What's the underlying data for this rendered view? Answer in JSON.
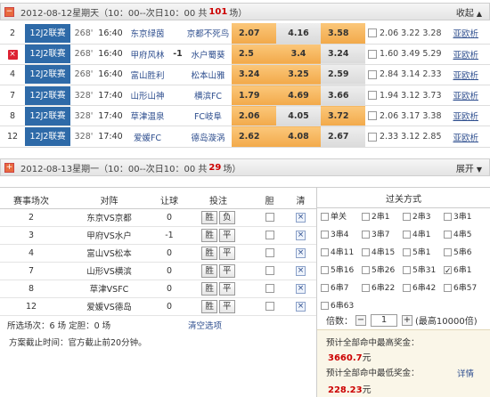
{
  "day1": {
    "date": "2012-08-12星期天",
    "period": "（10：00--次日10：00 共",
    "count": "101",
    "unit": "场）",
    "action": "收起",
    "arrow": "▲",
    "toggle": "−"
  },
  "day2": {
    "date": "2012-08-13星期一",
    "period": "（10：00--次日10：00 共",
    "count": "29",
    "unit": "场）",
    "action": "展开",
    "arrow": "▼",
    "toggle": "+"
  },
  "matches": [
    {
      "no": "2",
      "league": "12J2联赛",
      "id": "268'",
      "time": "16:40",
      "home": "东京绿茵",
      "hc": "",
      "away": "京都不死鸟",
      "o1": "2.07",
      "o2": "4.16",
      "o3": "3.58",
      "hist": "2.06 3.22 3.28",
      "link": "亚欧析"
    },
    {
      "no": "×",
      "league": "12J2联赛",
      "id": "268'",
      "time": "16:40",
      "home": "甲府风林",
      "hc": "-1",
      "away": "水户蜀葵",
      "o1": "2.5",
      "o2": "3.4",
      "o3": "3.24",
      "hist": "1.60 3.49 5.29",
      "link": "亚欧析"
    },
    {
      "no": "4",
      "league": "12J2联赛",
      "id": "268'",
      "time": "16:40",
      "home": "富山胜利",
      "hc": "",
      "away": "松本山雅",
      "o1": "3.24",
      "o2": "3.25",
      "o3": "2.59",
      "hist": "2.84 3.14 2.33",
      "link": "亚欧析"
    },
    {
      "no": "7",
      "league": "12J2联赛",
      "id": "328'",
      "time": "17:40",
      "home": "山形山神",
      "hc": "",
      "away": "横滨FC",
      "o1": "1.79",
      "o2": "4.69",
      "o3": "3.66",
      "hist": "1.94 3.12 3.73",
      "link": "亚欧析"
    },
    {
      "no": "8",
      "league": "12J2联赛",
      "id": "328'",
      "time": "17:40",
      "home": "草津温泉",
      "hc": "",
      "away": "FC岐阜",
      "o1": "2.06",
      "o2": "4.05",
      "o3": "3.72",
      "hist": "2.06 3.17 3.38",
      "link": "亚欧析"
    },
    {
      "no": "12",
      "league": "12J2联赛",
      "id": "328'",
      "time": "17:40",
      "home": "爱媛FC",
      "hc": "",
      "away": "德岛漩涡",
      "o1": "2.62",
      "o2": "4.08",
      "o3": "2.67",
      "hist": "2.33 3.12 2.85",
      "link": "亚欧析"
    }
  ],
  "selection": {
    "headers": [
      "赛事场次",
      "对阵",
      "让球",
      "投注",
      "胆",
      "清"
    ],
    "rows": [
      {
        "no": "2",
        "match": "东京VS京都",
        "hc": "0",
        "bets": [
          "胜",
          "负"
        ]
      },
      {
        "no": "3",
        "match": "甲府VS水户",
        "hc": "-1",
        "bets": [
          "胜",
          "平"
        ]
      },
      {
        "no": "4",
        "match": "富山VS松本",
        "hc": "0",
        "bets": [
          "胜",
          "平"
        ]
      },
      {
        "no": "7",
        "match": "山形VS横滨",
        "hc": "0",
        "bets": [
          "胜",
          "平"
        ]
      },
      {
        "no": "8",
        "match": "草津VSFC",
        "hc": "0",
        "bets": [
          "胜",
          "平"
        ]
      },
      {
        "no": "12",
        "match": "爱媛VS德岛",
        "hc": "0",
        "bets": [
          "胜",
          "平"
        ]
      }
    ],
    "del": "×",
    "summary": "所选场次：6 场 定胆：0 场",
    "clear": "清空选项",
    "note": "方案截止时间：官方截止前20分钟。"
  },
  "pass": {
    "title": "过关方式",
    "options": [
      "单关",
      "2串1",
      "2串3",
      "3串1",
      "3串4",
      "3串7",
      "4串1",
      "4串5",
      "4串11",
      "4串15",
      "5串1",
      "5串6",
      "5串16",
      "5串26",
      "5串31",
      "6串1",
      "6串7",
      "6串22",
      "6串42",
      "6串57",
      "6串63"
    ],
    "checked": "6串1"
  },
  "multiple": {
    "label": "倍数：",
    "minus": "−",
    "value": "1",
    "plus": "+",
    "hint": "(最高10000倍)"
  },
  "prize": {
    "max_label": "预计全部命中最高奖金：",
    "max_value": "3660.7",
    "min_label": "预计全部命中最低奖金：",
    "min_value": "228.23",
    "unit": "元",
    "detail": "详情"
  }
}
